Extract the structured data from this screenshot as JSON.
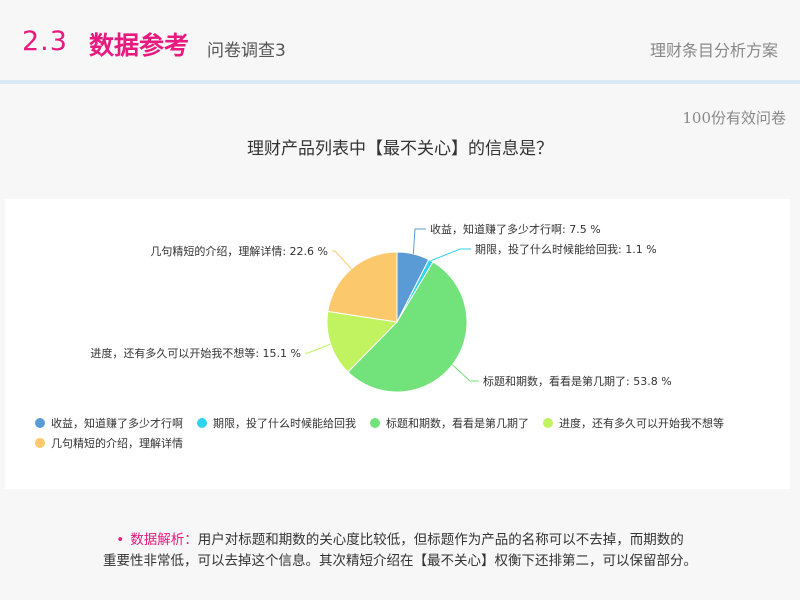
{
  "header": {
    "section_number": "2.3",
    "section_title": "数据参考",
    "subtitle": "问卷调查3",
    "right_title": "理财条目分析方案"
  },
  "sample_note": "100份有效问卷",
  "question": "理财产品列表中【最不关心】的信息是？",
  "chart_data": {
    "type": "pie",
    "title": "",
    "start_angle_deg": 0,
    "direction": "clockwise",
    "slices": [
      {
        "name": "收益，知道赚了多少才行啊",
        "value": 7.5,
        "label": "收益，知道赚了多少才行啊: 7.5 %",
        "color": "#5b9bd5"
      },
      {
        "name": "期限，投了什么时候能给回我",
        "value": 1.1,
        "label": "期限，投了什么时候能给回我: 1.1 %",
        "color": "#2ed4ee"
      },
      {
        "name": "标题和期数，看看是第几期了",
        "value": 53.8,
        "label": "标题和期数，看看是第几期了: 53.8 %",
        "color": "#72e27a"
      },
      {
        "name": "进度，还有多久可以开始我不想等",
        "value": 15.1,
        "label": "进度，还有多久可以开始我不想等: 15.1 %",
        "color": "#c1f260"
      },
      {
        "name": "几句精短的介绍，理解详情",
        "value": 22.6,
        "label": "几句精短的介绍，理解详情: 22.6 %",
        "color": "#fbc86b"
      }
    ],
    "legend_position": "bottom"
  },
  "analysis": {
    "label": "数据解析：",
    "line1": "用户对标题和期数的关心度比较低，但标题作为产品的名称可以不去掉，而期数的",
    "line2": "重要性非常低，可以去掉这个信息。其次精短介绍在【最不关心】权衡下还排第二，可以保留部分。"
  }
}
